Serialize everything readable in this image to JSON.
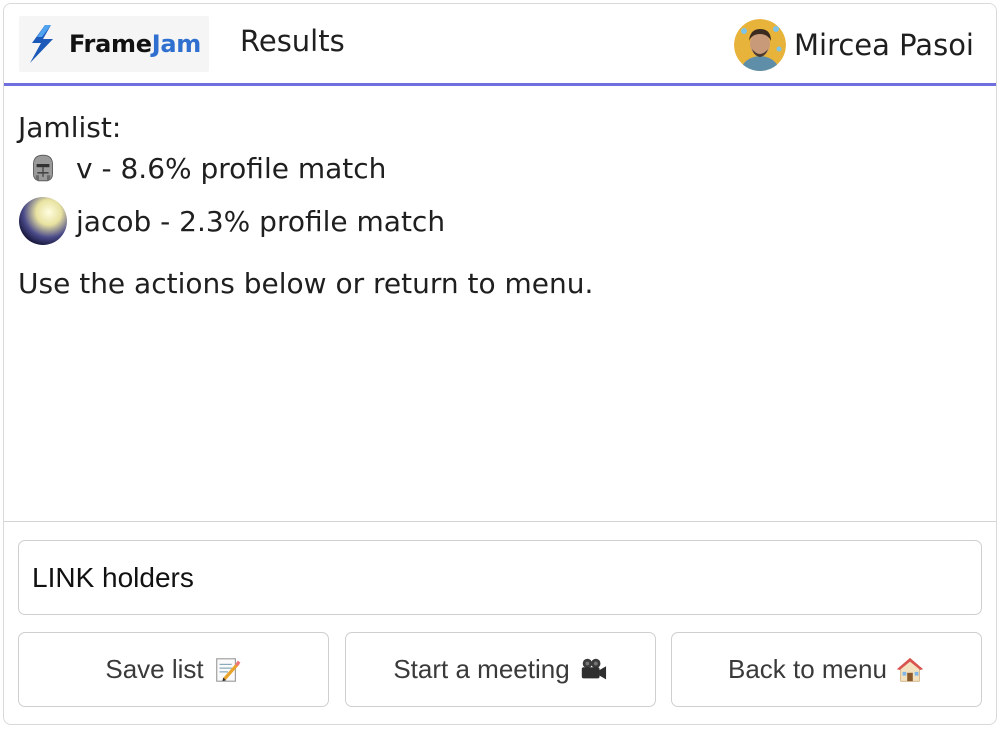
{
  "header": {
    "brand_part1": "Frame",
    "brand_part2": "Jam",
    "title": "Results",
    "user_name": "Mircea Pasoi"
  },
  "content": {
    "heading": "Jamlist:",
    "items": [
      {
        "icon": "mask-icon",
        "text": "v - 8.6% profile match"
      },
      {
        "icon": "orb-icon",
        "text": "jacob - 2.3% profile match"
      }
    ],
    "note": "Use the actions below or return to menu."
  },
  "input": {
    "value": "LINK holders"
  },
  "buttons": [
    {
      "label": "Save list",
      "icon": "memo-icon"
    },
    {
      "label": "Start a meeting",
      "icon": "video-camera-icon"
    },
    {
      "label": "Back to menu",
      "icon": "house-icon"
    }
  ],
  "colors": {
    "accent_line": "#6f6fe0",
    "brand_blue": "#2e6fd0"
  }
}
